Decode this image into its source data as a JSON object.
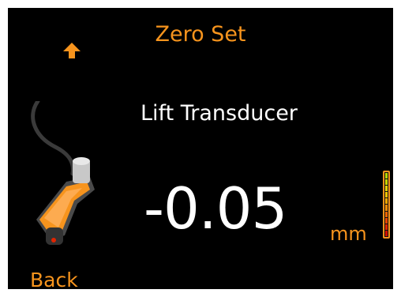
{
  "screen": {
    "title": "Zero Set",
    "subtitle": "Lift Transducer",
    "reading": "-0.05",
    "unit": "mm",
    "back_label": "Back",
    "icons": {
      "up": "up-arrow-icon",
      "probe": "transducer-probe-icon"
    },
    "meter_colors": [
      "#b3d600",
      "#c9d400",
      "#e3d000",
      "#f3c400",
      "#f6a800",
      "#f38b00",
      "#ee6500",
      "#e84600",
      "#e02400",
      "#d40f00"
    ],
    "colors": {
      "accent": "#f7941d",
      "text": "#ffffff",
      "background": "#000000"
    }
  }
}
